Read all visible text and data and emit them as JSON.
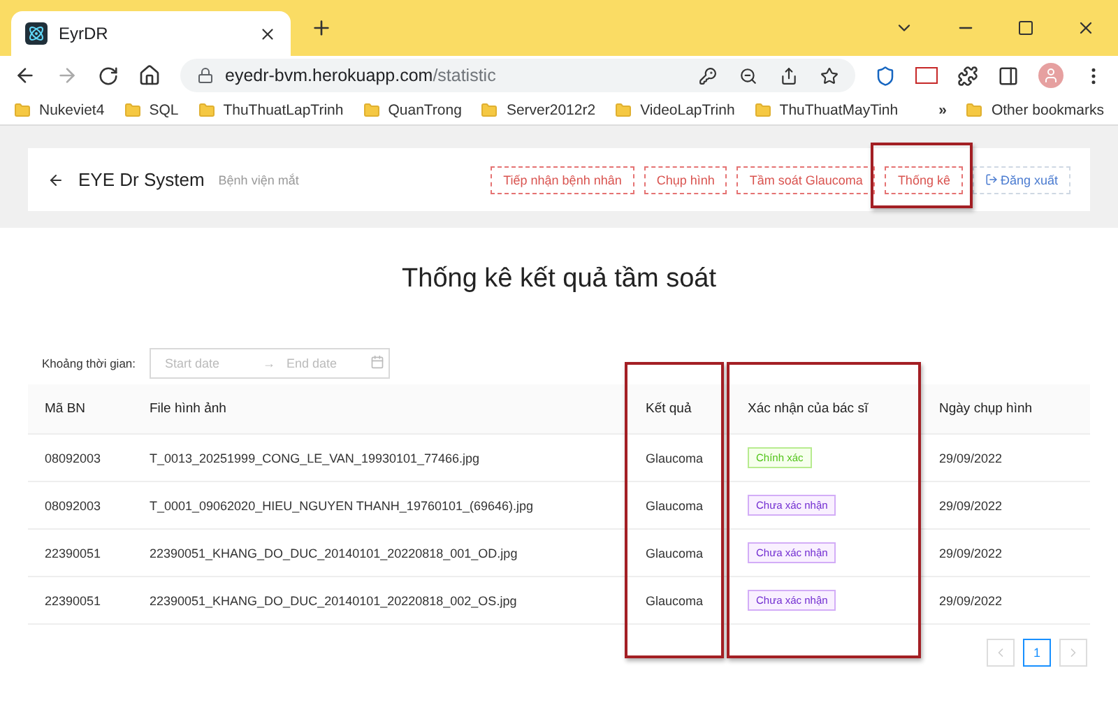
{
  "browser": {
    "tab_title": "EyrDR",
    "url_host": "eyedr-bvm.herokuapp.com",
    "url_path": "/statistic",
    "bookmarks": [
      "Nukeviet4",
      "SQL",
      "ThuThuatLapTrinh",
      "QuanTrong",
      "Server2012r2",
      "VideoLapTrinh",
      "ThuThuatMayTinh"
    ],
    "overflow": "»",
    "other_bookmarks": "Other bookmarks"
  },
  "header": {
    "title": "EYE Dr System",
    "subtitle": "Bệnh viện mắt",
    "nav": [
      {
        "label": "Tiếp nhận bệnh nhân",
        "highlighted": false
      },
      {
        "label": "Chụp hình",
        "highlighted": false
      },
      {
        "label": "Tầm soát Glaucoma",
        "highlighted": false
      },
      {
        "label": "Thống kê",
        "highlighted": true
      }
    ],
    "logout": "Đăng xuất"
  },
  "page_title": "Thống kê kết quả tầm soát",
  "filter": {
    "label": "Khoảng thời gian:",
    "start_placeholder": "Start date",
    "end_placeholder": "End date",
    "separator": "→"
  },
  "table": {
    "columns": [
      {
        "label": "Mã BN",
        "highlighted": false
      },
      {
        "label": "File hình ảnh",
        "highlighted": false
      },
      {
        "label": "Kết quả",
        "highlighted": true
      },
      {
        "label": "Xác nhận của bác sĩ",
        "highlighted": true
      },
      {
        "label": "Ngày chụp hình",
        "highlighted": false
      }
    ],
    "rows": [
      {
        "id": "08092003",
        "file": "T_0013_20251999_CONG_LE_VAN_19930101_77466.jpg",
        "result": "Glaucoma",
        "status": {
          "label": "Chính xác",
          "kind": "confirmed"
        },
        "date": "29/09/2022"
      },
      {
        "id": "08092003",
        "file": "T_0001_09062020_HIEU_NGUYEN THANH_19760101_(69646).jpg",
        "result": "Glaucoma",
        "status": {
          "label": "Chưa xác nhận",
          "kind": "pending"
        },
        "date": "29/09/2022"
      },
      {
        "id": "22390051",
        "file": "22390051_KHANG_DO_DUC_20140101_20220818_001_OD.jpg",
        "result": "Glaucoma",
        "status": {
          "label": "Chưa xác nhận",
          "kind": "pending"
        },
        "date": "29/09/2022"
      },
      {
        "id": "22390051",
        "file": "22390051_KHANG_DO_DUC_20140101_20220818_002_OS.jpg",
        "result": "Glaucoma",
        "status": {
          "label": "Chưa xác nhận",
          "kind": "pending"
        },
        "date": "29/09/2022"
      }
    ]
  },
  "pagination": {
    "pages": [
      {
        "label": "1",
        "selected": true
      }
    ]
  }
}
